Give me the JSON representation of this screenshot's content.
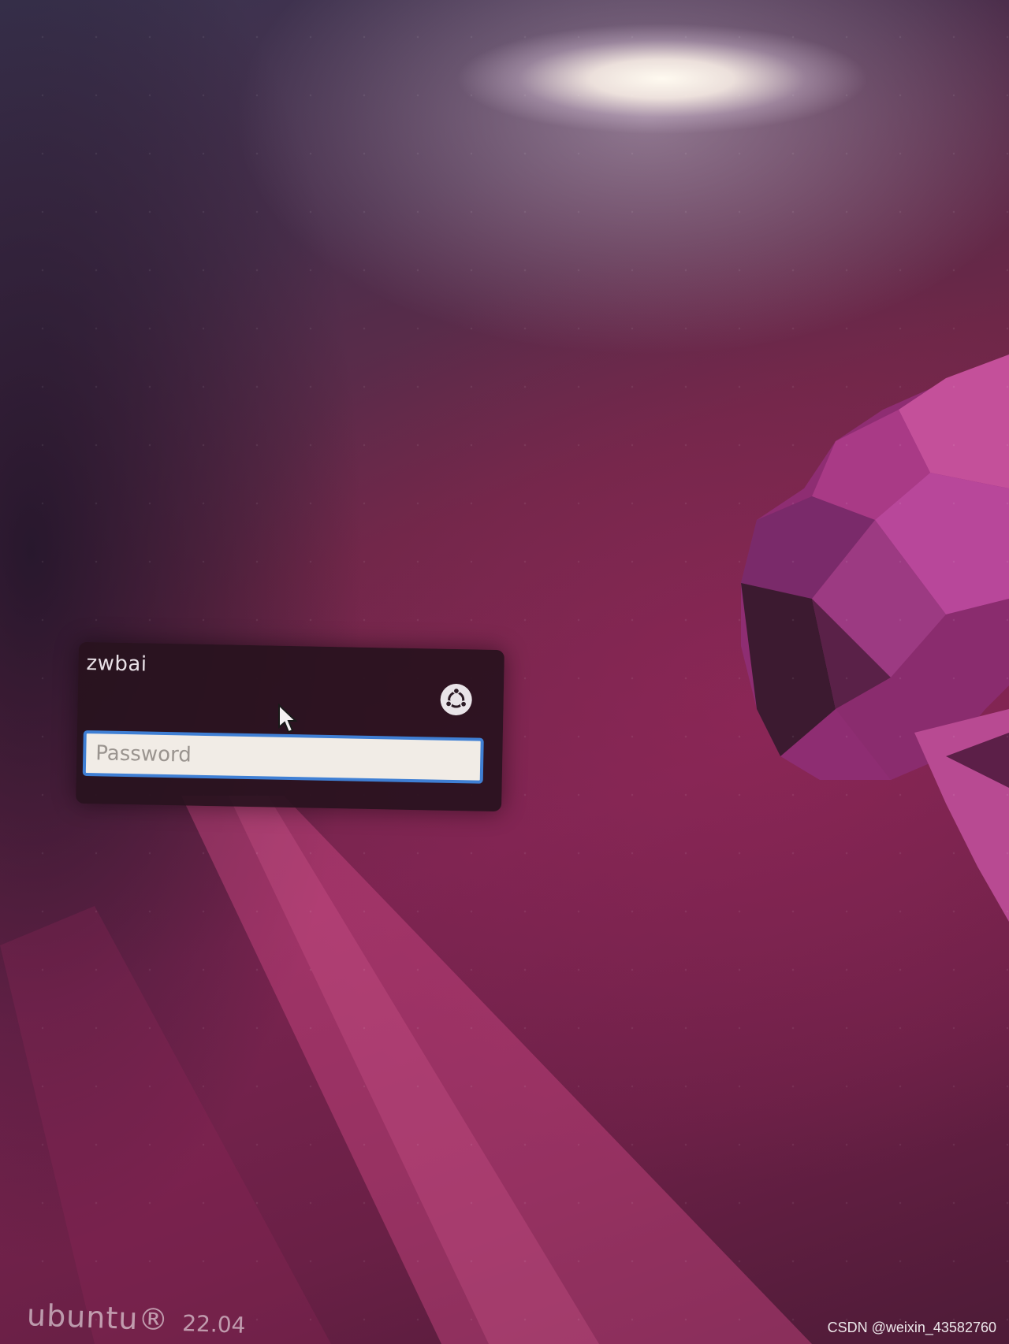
{
  "login": {
    "username": "zwbai",
    "password_placeholder": "Password",
    "session_icon": "ubuntu-logo-icon"
  },
  "branding": {
    "name": "ubuntu®",
    "version": "22.04"
  },
  "watermark": "CSDN @weixin_43582760",
  "colors": {
    "accent_focus": "#3f7fd4",
    "wallpaper_base": "#7a2450",
    "dialog_bg": "#28121e"
  }
}
